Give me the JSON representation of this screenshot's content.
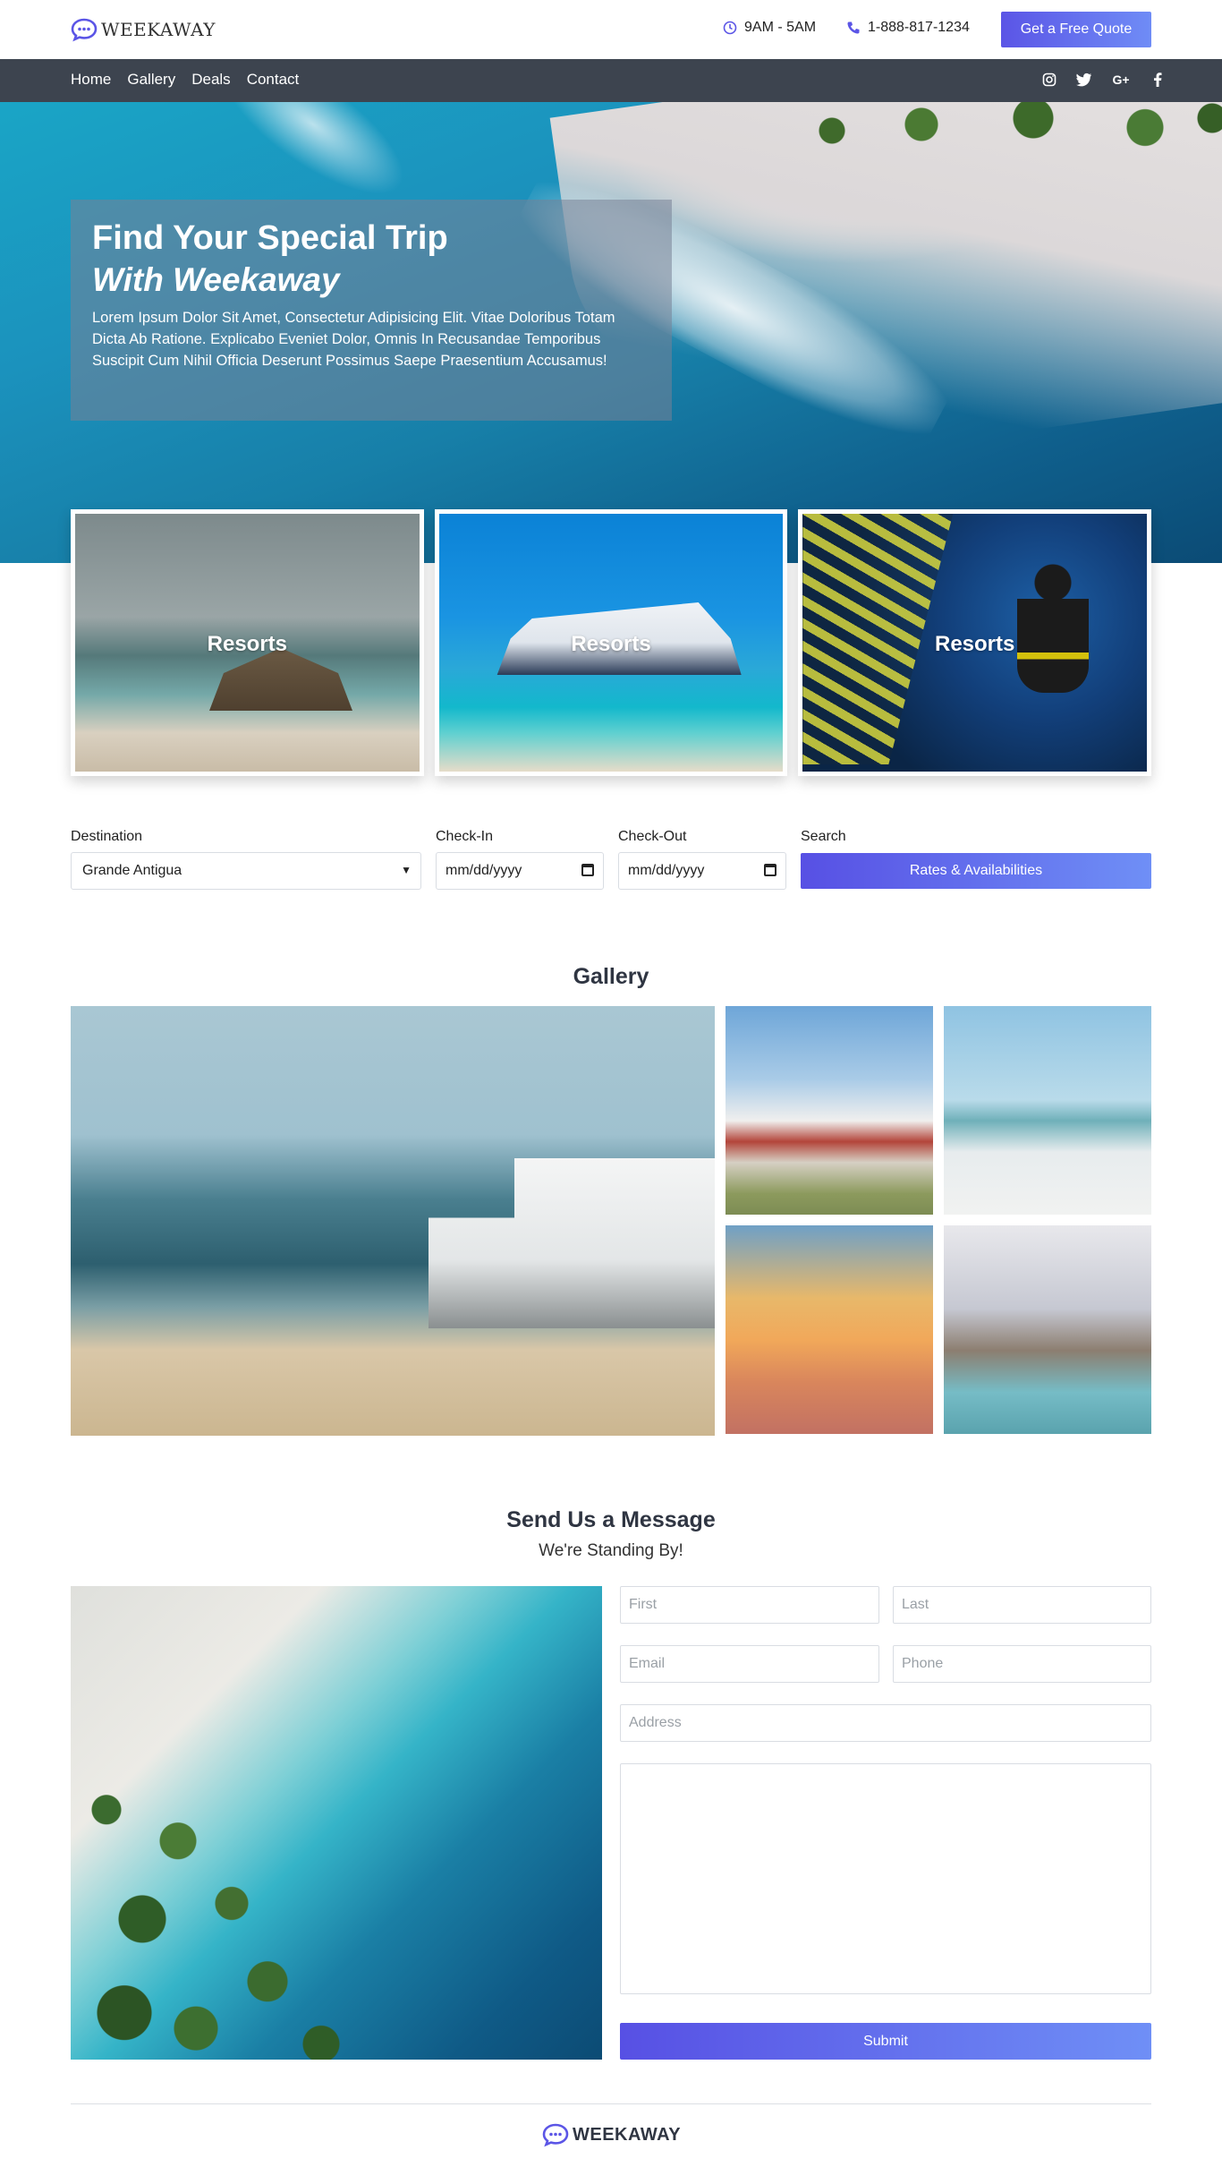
{
  "brand": {
    "name": "WEEKAWAY",
    "accent": "#5b55e6"
  },
  "header": {
    "hours": "9AM - 5AM",
    "phone": "1-888-817-1234",
    "quote_button": "Get a Free Quote",
    "hours_icon": "clock-icon",
    "phone_icon": "phone-icon"
  },
  "nav": {
    "items": [
      {
        "label": "Home"
      },
      {
        "label": "Gallery"
      },
      {
        "label": "Deals"
      },
      {
        "label": "Contact"
      }
    ],
    "socials": [
      {
        "icon": "instagram-icon",
        "glyph": "◎"
      },
      {
        "icon": "twitter-icon",
        "glyph": "🐦"
      },
      {
        "icon": "google-plus-icon",
        "glyph": "G+"
      },
      {
        "icon": "facebook-icon",
        "glyph": "f"
      }
    ]
  },
  "hero": {
    "title_line1": "Find Your Special Trip",
    "title_line2": "With Weekaway",
    "text": "Lorem Ipsum Dolor Sit Amet, Consectetur Adipisicing Elit. Vitae Doloribus Totam Dicta Ab Ratione. Explicabo Eveniet Dolor, Omnis In Recusandae Temporibus Suscipit Cum Nihil Officia Deserunt Possimus Saepe Praesentium Accusamus!"
  },
  "cards": [
    {
      "label": "Resorts"
    },
    {
      "label": "Resorts"
    },
    {
      "label": "Resorts"
    }
  ],
  "search": {
    "destination_label": "Destination",
    "destination_value": "Grande Antigua",
    "checkin_label": "Check-In",
    "checkin_value": "mm/dd/yyyy",
    "checkout_label": "Check-Out",
    "checkout_value": "mm/dd/yyyy",
    "search_label": "Search",
    "button": "Rates & Availabilities"
  },
  "gallery": {
    "title": "Gallery"
  },
  "contact": {
    "title": "Send Us a Message",
    "subtitle": "We're Standing By!",
    "first_placeholder": "First",
    "last_placeholder": "Last",
    "email_placeholder": "Email",
    "phone_placeholder": "Phone",
    "address_placeholder": "Address",
    "submit": "Submit"
  },
  "footer": {
    "brand": "WEEKAWAY"
  }
}
